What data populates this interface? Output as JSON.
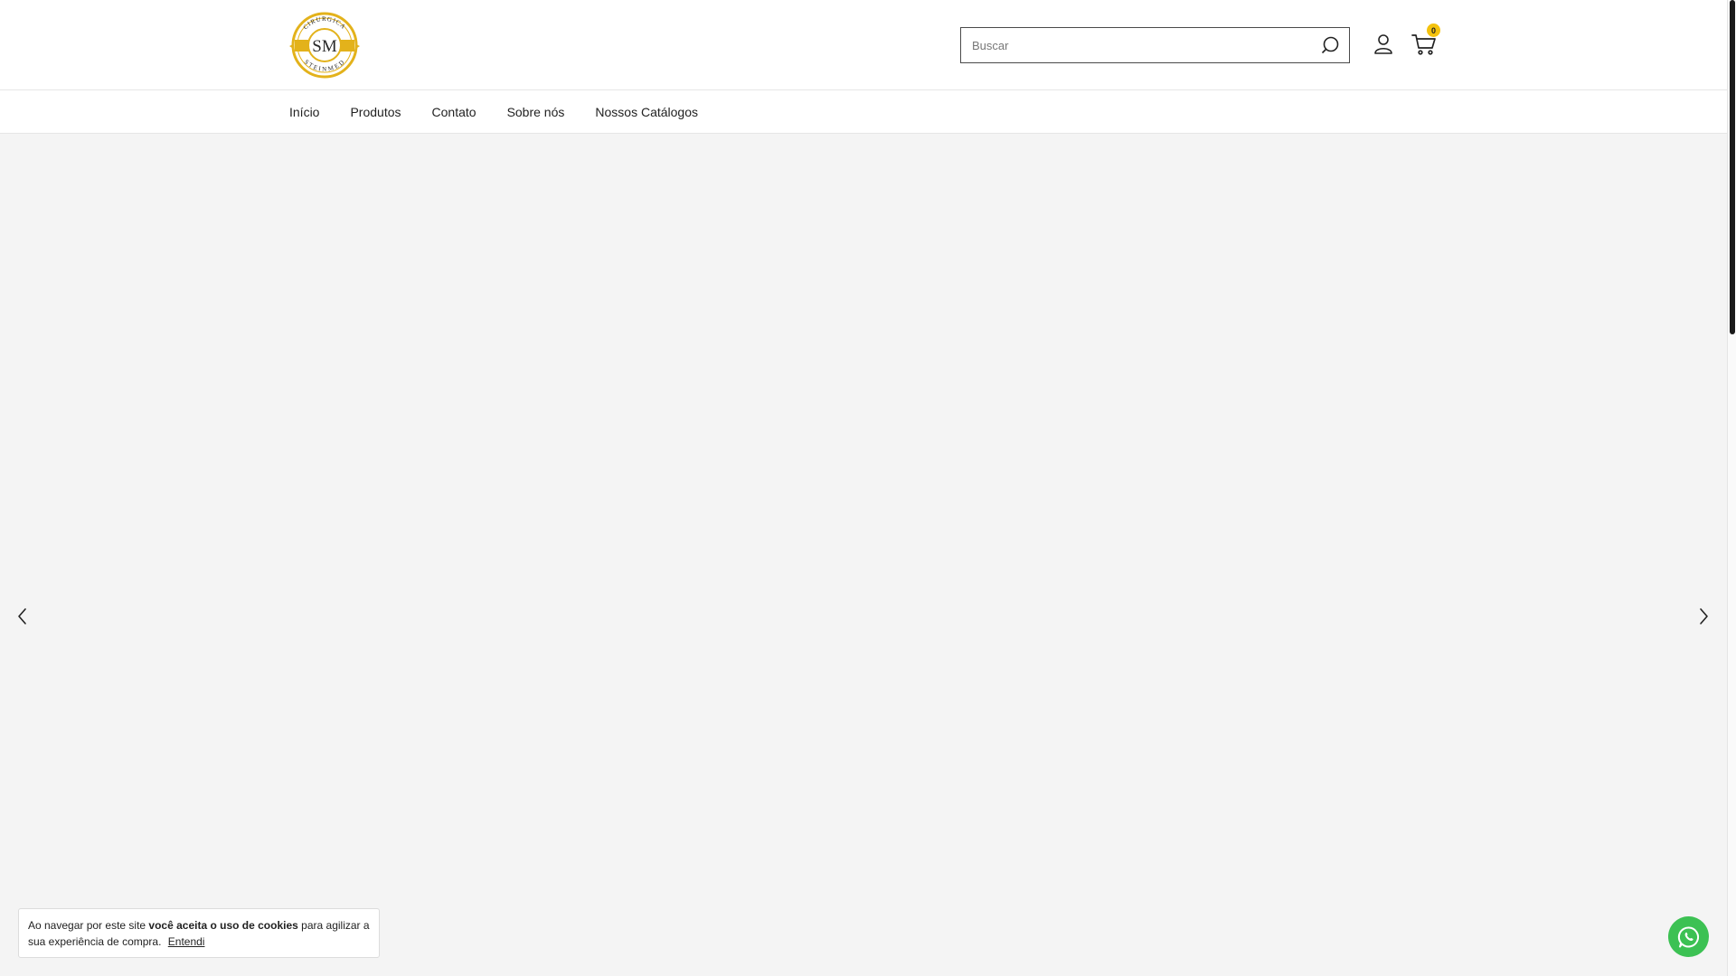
{
  "header": {
    "logo": {
      "top_text": "CIRURGICA",
      "monogram": "SM",
      "bottom_text": "STEINMED",
      "gold": "#e3b21b",
      "dark": "#2a2a2a"
    },
    "search": {
      "placeholder": "Buscar",
      "value": ""
    },
    "cart": {
      "count": "0",
      "badge_color": "#f4c20d"
    }
  },
  "nav": {
    "items": [
      {
        "label": "Início"
      },
      {
        "label": "Produtos"
      },
      {
        "label": "Contato"
      },
      {
        "label": "Sobre nós"
      },
      {
        "label": "Nossos Catálogos"
      }
    ]
  },
  "hero": {
    "background": "#f4f4f4"
  },
  "cookie": {
    "text_before": "Ao navegar por este site ",
    "text_bold": "você aceita o uso de cookies",
    "text_after": " para agilizar a sua experiência de compra.",
    "button_label": "Entendi"
  },
  "whatsapp": {
    "color": "#3cc153"
  },
  "icons": {
    "search": "search-icon",
    "account": "user-icon",
    "cart": "cart-icon",
    "prev": "chevron-left-icon",
    "next": "chevron-right-icon",
    "whatsapp": "whatsapp-icon"
  }
}
